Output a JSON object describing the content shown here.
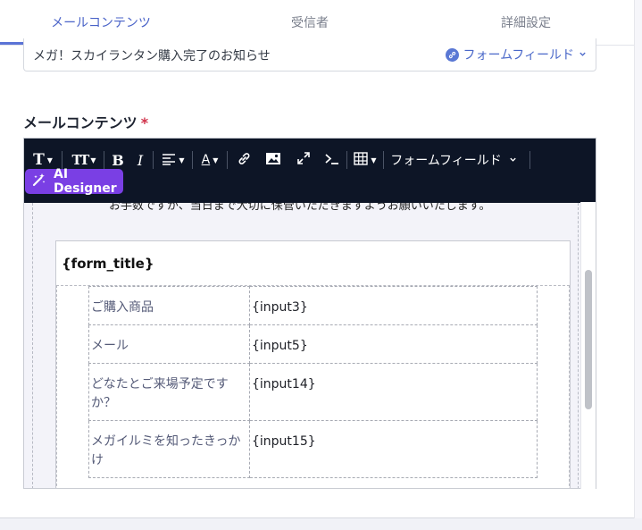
{
  "tabs": [
    {
      "label": "メールコンテンツ",
      "active": true
    },
    {
      "label": "受信者",
      "active": false
    },
    {
      "label": "詳細設定",
      "active": false
    }
  ],
  "subject": {
    "value": "メガ！スカイランタン購入完了のお知らせ",
    "form_field_label": "フォームフィールド"
  },
  "section": {
    "label": "メールコンテンツ",
    "required_mark": "*"
  },
  "toolbar": {
    "text_style_label": "T",
    "text_size_label": "TT",
    "bold_label": "B",
    "italic_label": "I",
    "font_color_label": "A",
    "form_field_label": "フォームフィールド",
    "ai_designer_label": "AI Designer"
  },
  "editor": {
    "intro_text": "お手数ですが、当日まで大切に保管いただきますようお願いいたします。",
    "form_title": "{form_title}",
    "rows": [
      {
        "label": "ご購入商品",
        "value": "{input3}"
      },
      {
        "label": "メール",
        "value": "{input5}"
      },
      {
        "label": "どなたとご来場予定ですか？",
        "value": "{input14}"
      },
      {
        "label": "メガイルミを知ったきっかけ",
        "value": "{input15}"
      }
    ]
  },
  "colors": {
    "accent": "#5b73d6",
    "toolbar_bg": "#0d1526",
    "ai_button": "#7a3fe4",
    "required": "#d0324a"
  }
}
